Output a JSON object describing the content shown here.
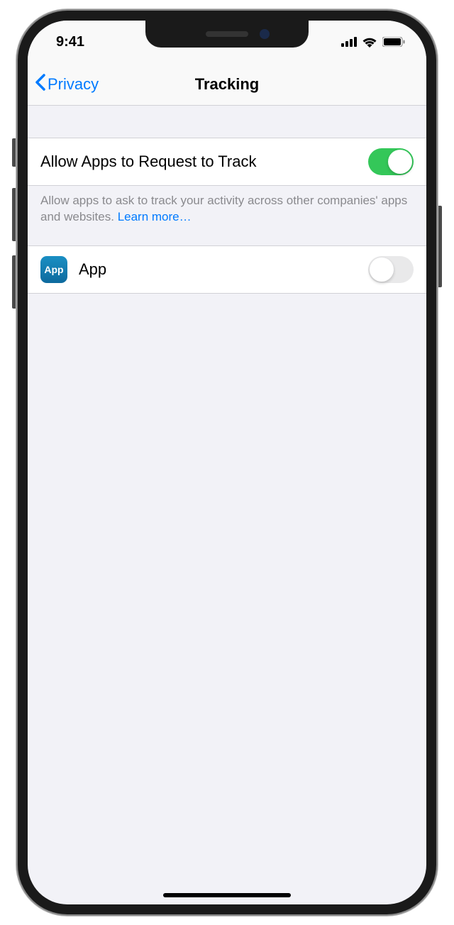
{
  "status": {
    "time": "9:41"
  },
  "nav": {
    "back_label": "Privacy",
    "title": "Tracking"
  },
  "main_toggle": {
    "label": "Allow Apps to Request to Track",
    "on": true
  },
  "footer": {
    "text": "Allow apps to ask to track your activity across other companies' apps and websites. ",
    "link": "Learn more…"
  },
  "apps": [
    {
      "icon_label": "App",
      "name": "App",
      "on": false
    }
  ]
}
